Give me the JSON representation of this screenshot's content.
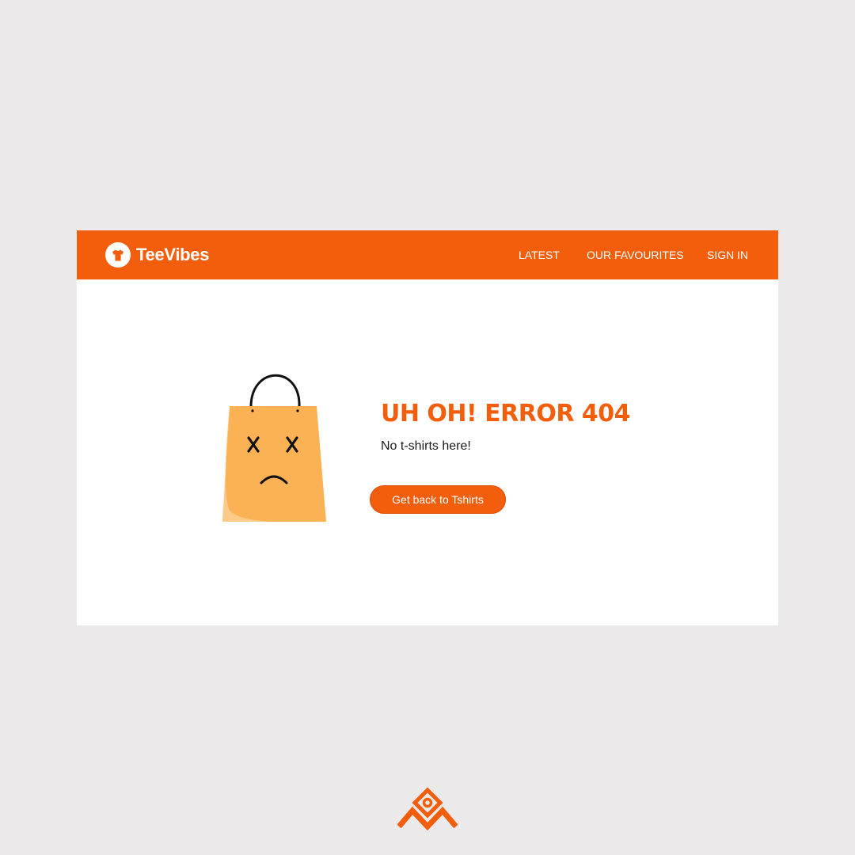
{
  "brand": {
    "name": "TeeVibes",
    "icon": "tshirt-logo-icon",
    "color": "#f25e0c"
  },
  "nav": {
    "items": [
      {
        "label": "LATEST"
      },
      {
        "label": "OUR FAVOURITES"
      },
      {
        "label": "SIGN IN"
      }
    ]
  },
  "error": {
    "title": "UH OH! ERROR 404",
    "subtitle": "No t-shirts here!",
    "illustration": "sad-shopping-bag-icon",
    "button_label": "Get back to Tshirts"
  },
  "colors": {
    "accent": "#f25e0c",
    "bag": "#fbb255",
    "background": "#ebe9e9"
  },
  "watermark": {
    "icon": "designer-logo-icon"
  }
}
